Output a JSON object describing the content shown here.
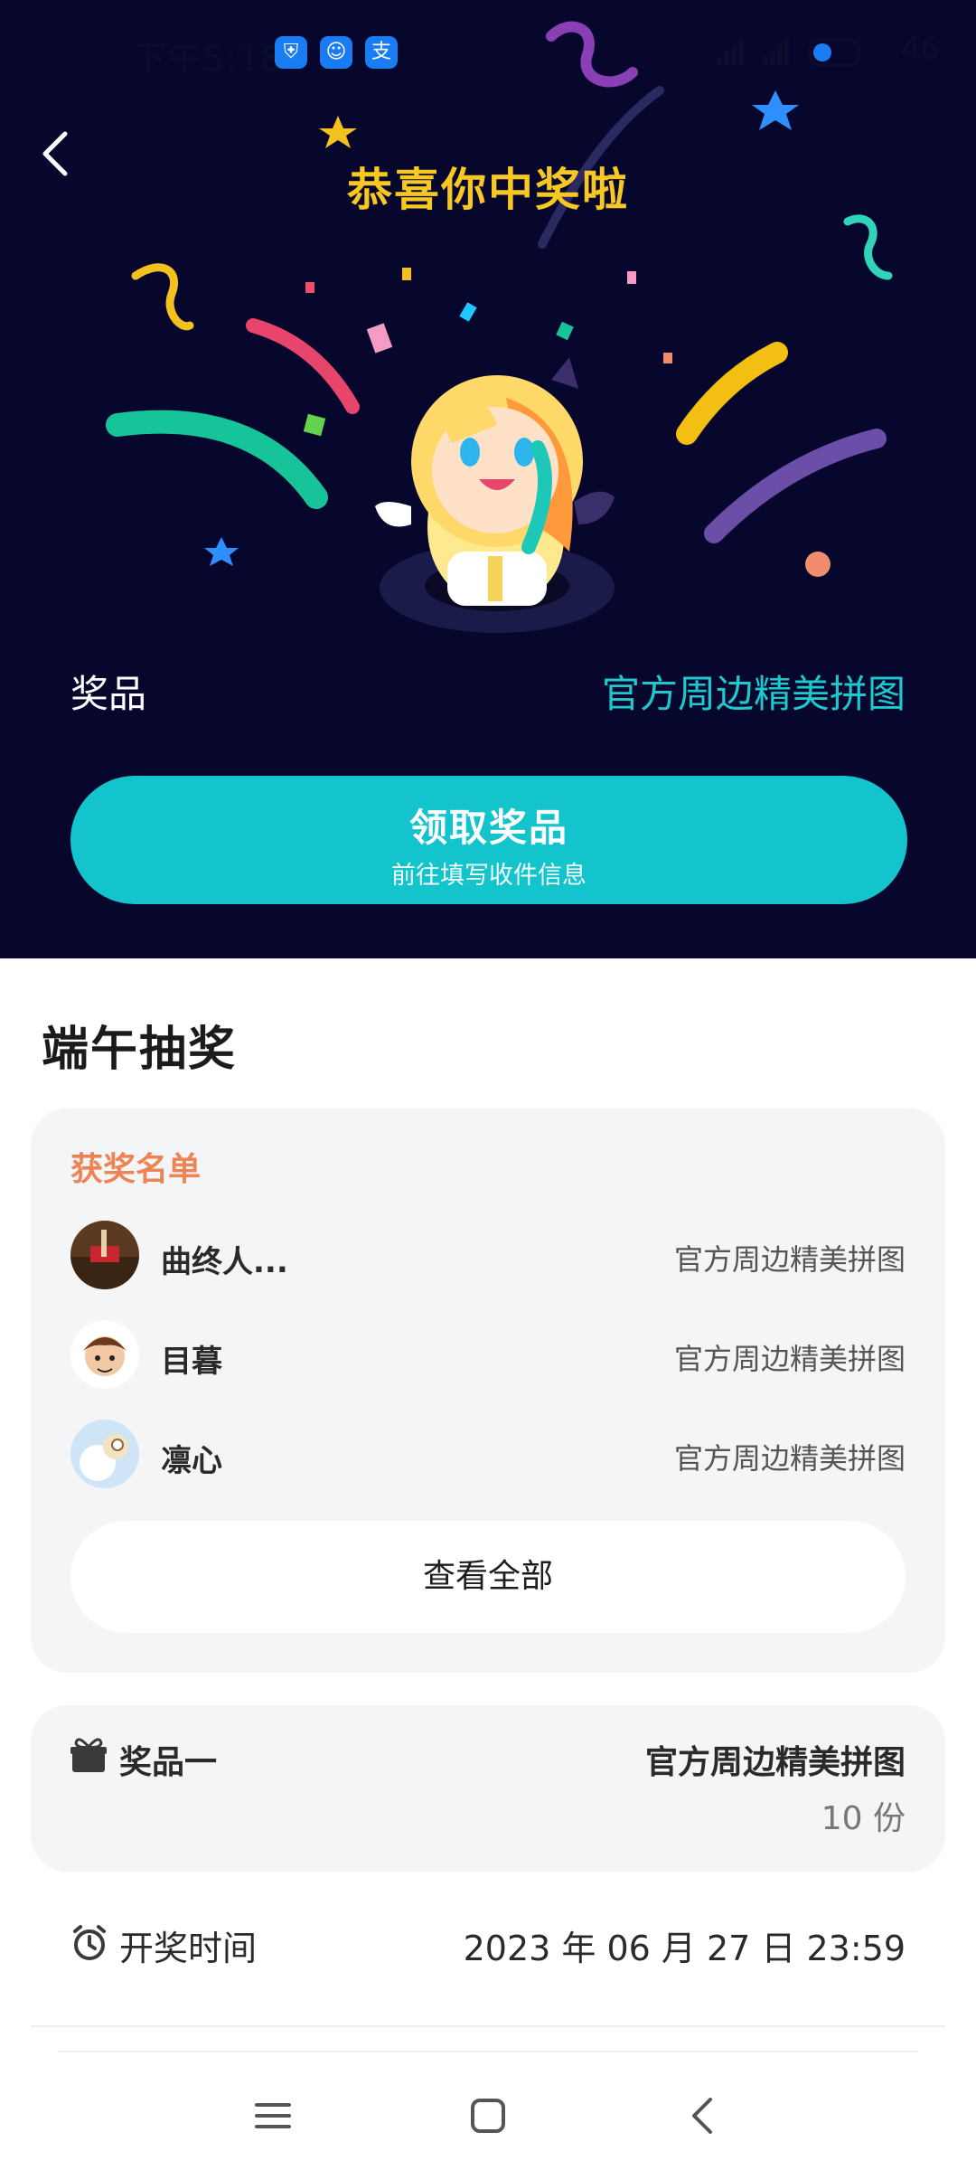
{
  "status_bar": {
    "time": "下午5:18",
    "apps": [
      "shield-app-icon",
      "chat-app-icon",
      "alipay-app-icon"
    ],
    "alipay_glyph": "支",
    "battery": "46"
  },
  "hero": {
    "title": "恭喜你中奖啦",
    "prize_label": "奖品",
    "prize_value": "官方周边精美拼图",
    "claim_button": {
      "label": "领取奖品",
      "sublabel": "前往填写收件信息"
    }
  },
  "event": {
    "title": "端午抽奖"
  },
  "winners": {
    "title": "获奖名单",
    "items": [
      {
        "name": "曲终人...",
        "prize": "官方周边精美拼图"
      },
      {
        "name": "目暮",
        "prize": "官方周边精美拼图"
      },
      {
        "name": "凛心",
        "prize": "官方周边精美拼图"
      }
    ],
    "view_all": "查看全部"
  },
  "prize_info": {
    "label": "奖品一",
    "name": "官方周边精美拼图",
    "quantity": "10 份"
  },
  "draw_time": {
    "label": "开奖时间",
    "value": "2023 年 06 月 27 日 23:59"
  },
  "colors": {
    "hero_bg": "#07072e",
    "accent_teal": "#14c4cc",
    "title_yellow": "#f7c824",
    "winners_orange": "#ee8455"
  }
}
